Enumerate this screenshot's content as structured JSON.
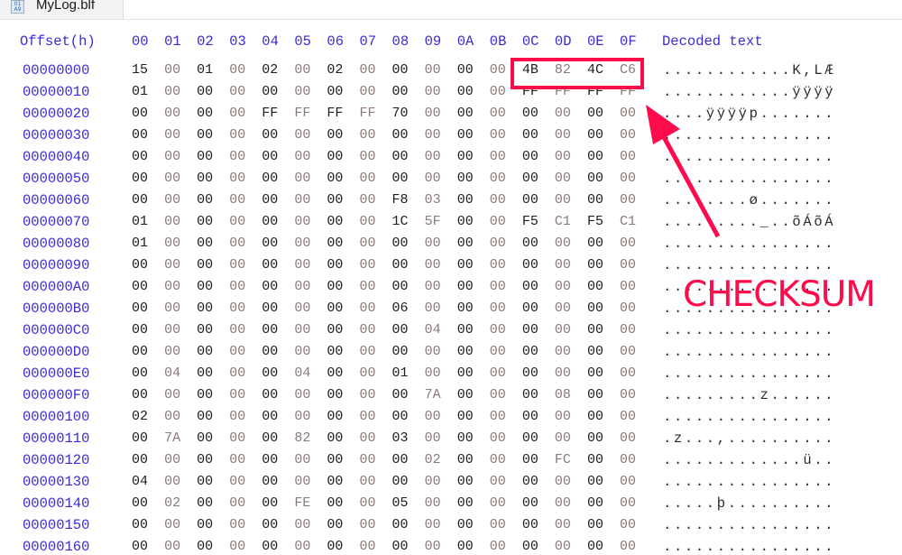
{
  "tab": {
    "icon": "hex-file-icon",
    "label": "MyLog.blf"
  },
  "header": {
    "offset_label": "Offset(h)",
    "columns": [
      "00",
      "01",
      "02",
      "03",
      "04",
      "05",
      "06",
      "07",
      "08",
      "09",
      "0A",
      "0B",
      "0C",
      "0D",
      "0E",
      "0F"
    ],
    "decoded_label": "Decoded text"
  },
  "rows": [
    {
      "offset": "00000000",
      "bytes": [
        "15",
        "00",
        "01",
        "00",
        "02",
        "00",
        "02",
        "00",
        "00",
        "00",
        "00",
        "00",
        "4B",
        "82",
        "4C",
        "C6"
      ],
      "text": "............K,LÆ"
    },
    {
      "offset": "00000010",
      "bytes": [
        "01",
        "00",
        "00",
        "00",
        "00",
        "00",
        "00",
        "00",
        "00",
        "00",
        "00",
        "00",
        "FF",
        "FF",
        "FF",
        "FF"
      ],
      "text": "............ÿÿÿÿ"
    },
    {
      "offset": "00000020",
      "bytes": [
        "00",
        "00",
        "00",
        "00",
        "FF",
        "FF",
        "FF",
        "FF",
        "70",
        "00",
        "00",
        "00",
        "00",
        "00",
        "00",
        "00"
      ],
      "text": "....ÿÿÿÿp......."
    },
    {
      "offset": "00000030",
      "bytes": [
        "00",
        "00",
        "00",
        "00",
        "00",
        "00",
        "00",
        "00",
        "00",
        "00",
        "00",
        "00",
        "00",
        "00",
        "00",
        "00"
      ],
      "text": "................"
    },
    {
      "offset": "00000040",
      "bytes": [
        "00",
        "00",
        "00",
        "00",
        "00",
        "00",
        "00",
        "00",
        "00",
        "00",
        "00",
        "00",
        "00",
        "00",
        "00",
        "00"
      ],
      "text": "................"
    },
    {
      "offset": "00000050",
      "bytes": [
        "00",
        "00",
        "00",
        "00",
        "00",
        "00",
        "00",
        "00",
        "00",
        "00",
        "00",
        "00",
        "00",
        "00",
        "00",
        "00"
      ],
      "text": "................"
    },
    {
      "offset": "00000060",
      "bytes": [
        "00",
        "00",
        "00",
        "00",
        "00",
        "00",
        "00",
        "00",
        "F8",
        "03",
        "00",
        "00",
        "00",
        "00",
        "00",
        "00"
      ],
      "text": "........ø......."
    },
    {
      "offset": "00000070",
      "bytes": [
        "01",
        "00",
        "00",
        "00",
        "00",
        "00",
        "00",
        "00",
        "1C",
        "5F",
        "00",
        "00",
        "F5",
        "C1",
        "F5",
        "C1"
      ],
      "text": "........._..õÁõÁ"
    },
    {
      "offset": "00000080",
      "bytes": [
        "01",
        "00",
        "00",
        "00",
        "00",
        "00",
        "00",
        "00",
        "00",
        "00",
        "00",
        "00",
        "00",
        "00",
        "00",
        "00"
      ],
      "text": "................"
    },
    {
      "offset": "00000090",
      "bytes": [
        "00",
        "00",
        "00",
        "00",
        "00",
        "00",
        "00",
        "00",
        "00",
        "00",
        "00",
        "00",
        "00",
        "00",
        "00",
        "00"
      ],
      "text": "................"
    },
    {
      "offset": "000000A0",
      "bytes": [
        "00",
        "00",
        "00",
        "00",
        "00",
        "00",
        "00",
        "00",
        "00",
        "00",
        "00",
        "00",
        "00",
        "00",
        "00",
        "00"
      ],
      "text": "................"
    },
    {
      "offset": "000000B0",
      "bytes": [
        "00",
        "00",
        "00",
        "00",
        "00",
        "00",
        "00",
        "00",
        "06",
        "00",
        "00",
        "00",
        "00",
        "00",
        "00",
        "00"
      ],
      "text": "................"
    },
    {
      "offset": "000000C0",
      "bytes": [
        "00",
        "00",
        "00",
        "00",
        "00",
        "00",
        "00",
        "00",
        "00",
        "04",
        "00",
        "00",
        "00",
        "00",
        "00",
        "00"
      ],
      "text": "................"
    },
    {
      "offset": "000000D0",
      "bytes": [
        "00",
        "00",
        "00",
        "00",
        "00",
        "00",
        "00",
        "00",
        "00",
        "00",
        "00",
        "00",
        "00",
        "00",
        "00",
        "00"
      ],
      "text": "................"
    },
    {
      "offset": "000000E0",
      "bytes": [
        "00",
        "04",
        "00",
        "00",
        "00",
        "04",
        "00",
        "00",
        "01",
        "00",
        "00",
        "00",
        "00",
        "00",
        "00",
        "00"
      ],
      "text": "................"
    },
    {
      "offset": "000000F0",
      "bytes": [
        "00",
        "00",
        "00",
        "00",
        "00",
        "00",
        "00",
        "00",
        "00",
        "7A",
        "00",
        "00",
        "00",
        "08",
        "00",
        "00"
      ],
      "text": ".........z......"
    },
    {
      "offset": "00000100",
      "bytes": [
        "02",
        "00",
        "00",
        "00",
        "00",
        "00",
        "00",
        "00",
        "00",
        "00",
        "00",
        "00",
        "00",
        "00",
        "00",
        "00"
      ],
      "text": "................"
    },
    {
      "offset": "00000110",
      "bytes": [
        "00",
        "7A",
        "00",
        "00",
        "00",
        "82",
        "00",
        "00",
        "03",
        "00",
        "00",
        "00",
        "00",
        "00",
        "00",
        "00"
      ],
      "text": ".z...,.........."
    },
    {
      "offset": "00000120",
      "bytes": [
        "00",
        "00",
        "00",
        "00",
        "00",
        "00",
        "00",
        "00",
        "00",
        "02",
        "00",
        "00",
        "00",
        "FC",
        "00",
        "00"
      ],
      "text": ".............ü.."
    },
    {
      "offset": "00000130",
      "bytes": [
        "04",
        "00",
        "00",
        "00",
        "00",
        "00",
        "00",
        "00",
        "00",
        "00",
        "00",
        "00",
        "00",
        "00",
        "00",
        "00"
      ],
      "text": "................"
    },
    {
      "offset": "00000140",
      "bytes": [
        "00",
        "02",
        "00",
        "00",
        "00",
        "FE",
        "00",
        "00",
        "05",
        "00",
        "00",
        "00",
        "00",
        "00",
        "00",
        "00"
      ],
      "text": ".....þ.........."
    },
    {
      "offset": "00000150",
      "bytes": [
        "00",
        "00",
        "00",
        "00",
        "00",
        "00",
        "00",
        "00",
        "00",
        "00",
        "00",
        "00",
        "00",
        "00",
        "00",
        "00"
      ],
      "text": "................"
    },
    {
      "offset": "00000160",
      "bytes": [
        "00",
        "00",
        "00",
        "00",
        "00",
        "00",
        "00",
        "00",
        "00",
        "00",
        "00",
        "00",
        "00",
        "00",
        "00",
        "00"
      ],
      "text": "................"
    }
  ],
  "annotation": {
    "label": "CHECKSUM",
    "color": "#ff0a4a",
    "highlighted_bytes": [
      "4B",
      "82",
      "4C",
      "C6"
    ],
    "highlighted_offset": "00000000",
    "highlighted_columns": [
      "0C",
      "0D",
      "0E",
      "0F"
    ]
  }
}
